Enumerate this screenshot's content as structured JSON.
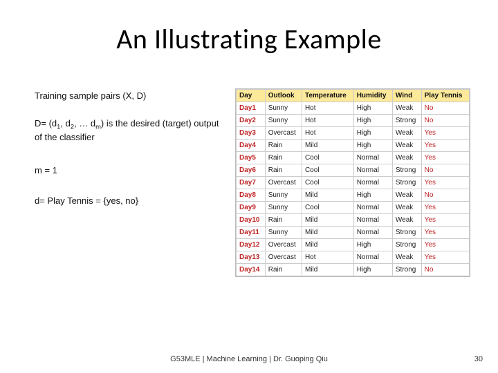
{
  "title": "An Illustrating Example",
  "lines": {
    "l1": "Training sample pairs (X, D)",
    "l2_pre": "D= (d",
    "l2_mid1": ", d",
    "l2_mid2": ", … d",
    "l2_post": ") is the desired (target) output of the classifier",
    "sub1": "1",
    "sub2": "2",
    "subm": "m",
    "l3": "m = 1",
    "l4": "d= Play Tennis = {yes, no}"
  },
  "table": {
    "headers": [
      "Day",
      "Outlook",
      "Temperature",
      "Humidity",
      "Wind",
      "Play Tennis"
    ],
    "rows": [
      [
        "Day1",
        "Sunny",
        "Hot",
        "High",
        "Weak",
        "No"
      ],
      [
        "Day2",
        "Sunny",
        "Hot",
        "High",
        "Strong",
        "No"
      ],
      [
        "Day3",
        "Overcast",
        "Hot",
        "High",
        "Weak",
        "Yes"
      ],
      [
        "Day4",
        "Rain",
        "Mild",
        "High",
        "Weak",
        "Yes"
      ],
      [
        "Day5",
        "Rain",
        "Cool",
        "Normal",
        "Weak",
        "Yes"
      ],
      [
        "Day6",
        "Rain",
        "Cool",
        "Normal",
        "Strong",
        "No"
      ],
      [
        "Day7",
        "Overcast",
        "Cool",
        "Normal",
        "Strong",
        "Yes"
      ],
      [
        "Day8",
        "Sunny",
        "Mild",
        "High",
        "Weak",
        "No"
      ],
      [
        "Day9",
        "Sunny",
        "Cool",
        "Normal",
        "Weak",
        "Yes"
      ],
      [
        "Day10",
        "Rain",
        "Mild",
        "Normal",
        "Weak",
        "Yes"
      ],
      [
        "Day11",
        "Sunny",
        "Mild",
        "Normal",
        "Strong",
        "Yes"
      ],
      [
        "Day12",
        "Overcast",
        "Mild",
        "High",
        "Strong",
        "Yes"
      ],
      [
        "Day13",
        "Overcast",
        "Hot",
        "Normal",
        "Weak",
        "Yes"
      ],
      [
        "Day14",
        "Rain",
        "Mild",
        "High",
        "Strong",
        "No"
      ]
    ]
  },
  "footer": "G53MLE |  Machine Learning | Dr. Guoping Qiu",
  "page_number": "30",
  "chart_data": {
    "type": "table",
    "title": "Play Tennis training examples",
    "columns": [
      "Day",
      "Outlook",
      "Temperature",
      "Humidity",
      "Wind",
      "Play Tennis"
    ],
    "rows": [
      [
        "Day1",
        "Sunny",
        "Hot",
        "High",
        "Weak",
        "No"
      ],
      [
        "Day2",
        "Sunny",
        "Hot",
        "High",
        "Strong",
        "No"
      ],
      [
        "Day3",
        "Overcast",
        "Hot",
        "High",
        "Weak",
        "Yes"
      ],
      [
        "Day4",
        "Rain",
        "Mild",
        "High",
        "Weak",
        "Yes"
      ],
      [
        "Day5",
        "Rain",
        "Cool",
        "Normal",
        "Weak",
        "Yes"
      ],
      [
        "Day6",
        "Rain",
        "Cool",
        "Normal",
        "Strong",
        "No"
      ],
      [
        "Day7",
        "Overcast",
        "Cool",
        "Normal",
        "Strong",
        "Yes"
      ],
      [
        "Day8",
        "Sunny",
        "Mild",
        "High",
        "Weak",
        "No"
      ],
      [
        "Day9",
        "Sunny",
        "Cool",
        "Normal",
        "Weak",
        "Yes"
      ],
      [
        "Day10",
        "Rain",
        "Mild",
        "Normal",
        "Weak",
        "Yes"
      ],
      [
        "Day11",
        "Sunny",
        "Mild",
        "Normal",
        "Strong",
        "Yes"
      ],
      [
        "Day12",
        "Overcast",
        "Mild",
        "High",
        "Strong",
        "Yes"
      ],
      [
        "Day13",
        "Overcast",
        "Hot",
        "Normal",
        "Weak",
        "Yes"
      ],
      [
        "Day14",
        "Rain",
        "Mild",
        "High",
        "Strong",
        "No"
      ]
    ]
  }
}
